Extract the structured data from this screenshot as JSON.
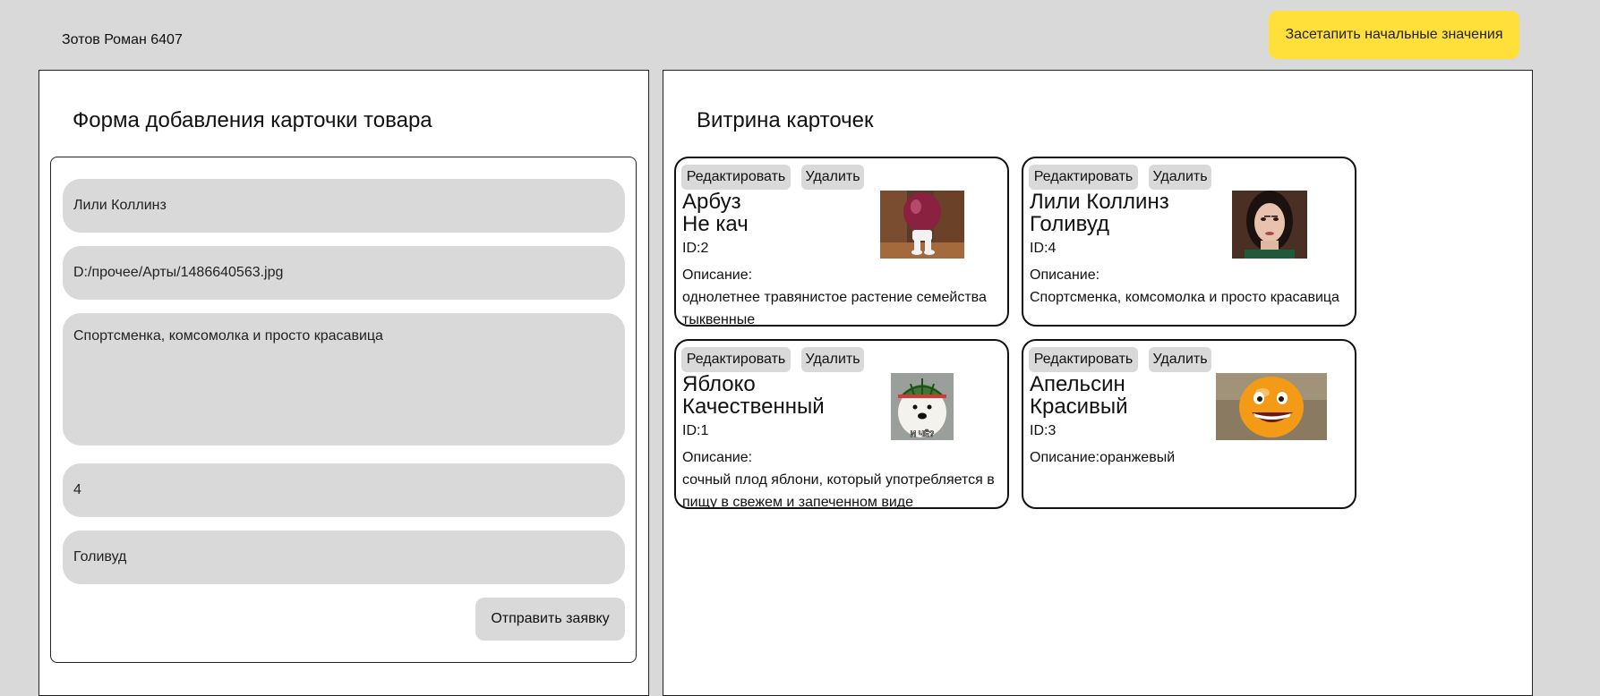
{
  "header": {
    "author": "Зотов Роман 6407",
    "reset_button": "Засетапить начальные значения"
  },
  "form_panel": {
    "title": "Форма добавления карточки товара",
    "fields": {
      "name": "Лили Коллинз",
      "image_path": "D:/прочее/Арты/1486640563.jpg",
      "description": "Спортсменка, комсомолка и просто красавица",
      "id": "4",
      "subtitle": "Голивуд"
    },
    "submit_button": "Отправить заявку"
  },
  "showcase_panel": {
    "title": "Витрина карточек",
    "edit_label": "Редактировать",
    "delete_label": "Удалить",
    "cards": [
      {
        "title": "Арбуз",
        "subtitle": "Не кач",
        "id": "ID:2",
        "description_label": "Описание:",
        "description": "однолетнее травянистое растение семейства тыквенные",
        "image": "watermelon-character-image"
      },
      {
        "title": "Лили Коллинз",
        "subtitle": "Голивуд",
        "id": "ID:4",
        "description_label": "Описание:",
        "description": "Спортсменка, комсомолка и просто красавица",
        "image": "woman-portrait-image"
      },
      {
        "title": "Яблоко",
        "subtitle": "Качественный",
        "id": "ID:1",
        "description_label": "Описание:",
        "description": "сочный плод яблони, который употребляется в пищу в свежем и запеченном виде",
        "image": "dog-in-watermelon-hat-image",
        "image_caption": "И ЧЁ?"
      },
      {
        "title": "Апельсин",
        "subtitle": "Красивый",
        "id": "ID:3",
        "description_label": "Описание:оранжевый",
        "description": "",
        "image": "annoying-orange-image"
      }
    ]
  },
  "colors": {
    "background": "#d9d9d9",
    "accent_button": "#ffe03a",
    "panel": "#ffffff",
    "border": "#111111"
  }
}
